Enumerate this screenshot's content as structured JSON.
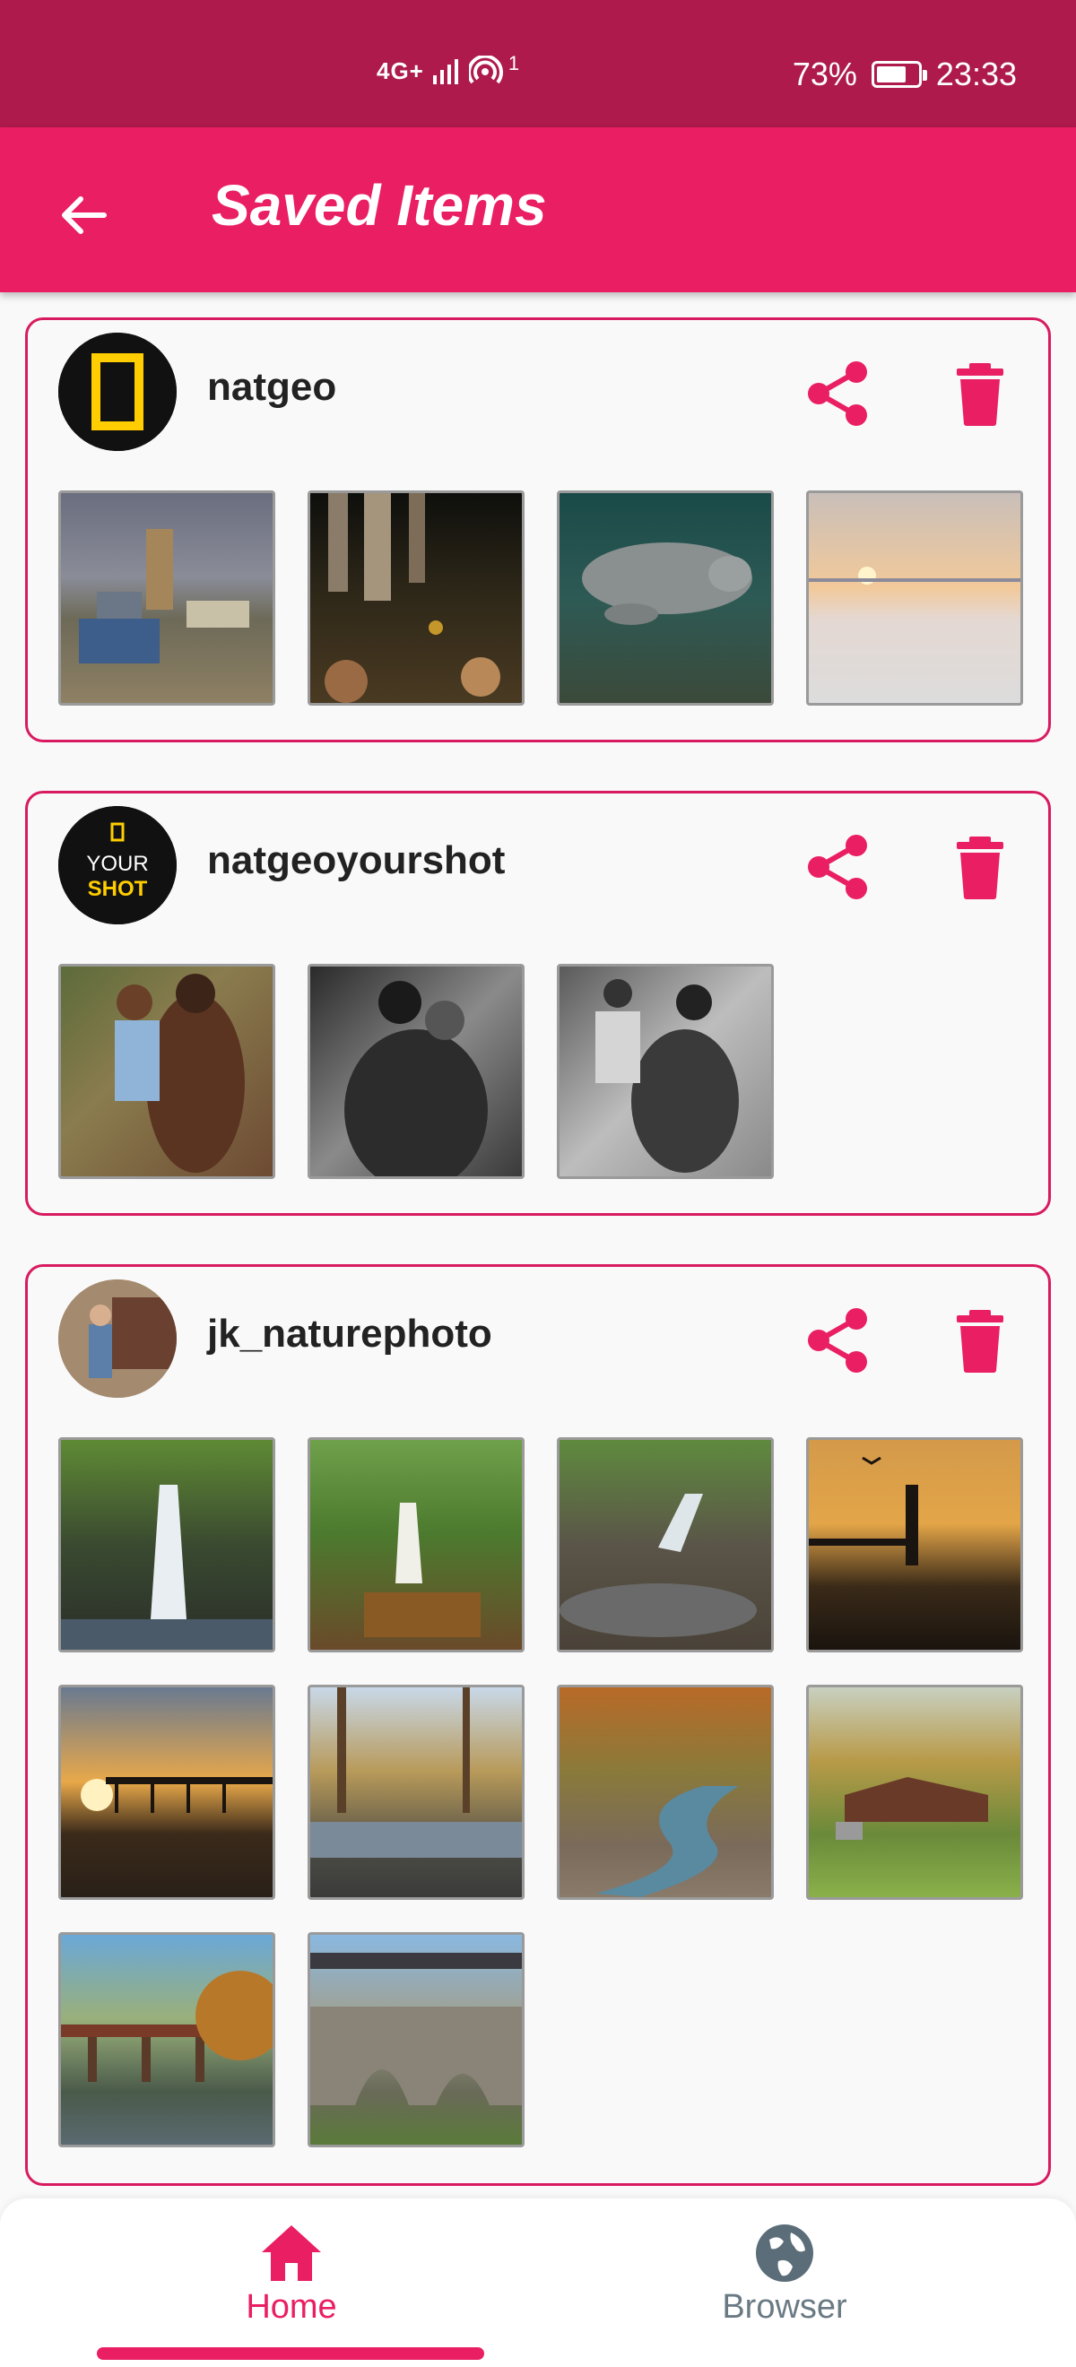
{
  "status_bar": {
    "network": "4G+",
    "hotspot_count": "1",
    "battery": "73%",
    "battery_level": 0.73,
    "time": "23:33"
  },
  "app_bar": {
    "title": "Saved Items",
    "back_icon": "arrow-back-icon"
  },
  "accent_color": "#e91e63",
  "cards": [
    {
      "username": "natgeo",
      "avatar_logo": "natgeo-logo",
      "image_count": 4,
      "images": [
        "camp-scene",
        "forest-floor",
        "manatee",
        "snowy-shore-sunset"
      ]
    },
    {
      "username": "natgeoyourshot",
      "avatar_logo_text": [
        "YOUR",
        "SHOT"
      ],
      "image_count": 3,
      "images": [
        "man-holding-child",
        "bw-back-portrait",
        "bw-flexing-man"
      ]
    },
    {
      "username": "jk_naturephoto",
      "avatar_logo": "profile-photo",
      "image_count": 10,
      "images": [
        "waterfall-1",
        "waterfall-2",
        "creek-waterfall",
        "lighthouse-sunset",
        "pier-sunset",
        "autumn-creek",
        "autumn-stream",
        "covered-bridge",
        "rail-bridge-autumn",
        "stone-arch-bridge"
      ]
    }
  ],
  "bottom_nav": {
    "items": [
      {
        "label": "Home",
        "icon": "home-icon",
        "active": true
      },
      {
        "label": "Browser",
        "icon": "globe-icon",
        "active": false
      }
    ]
  }
}
